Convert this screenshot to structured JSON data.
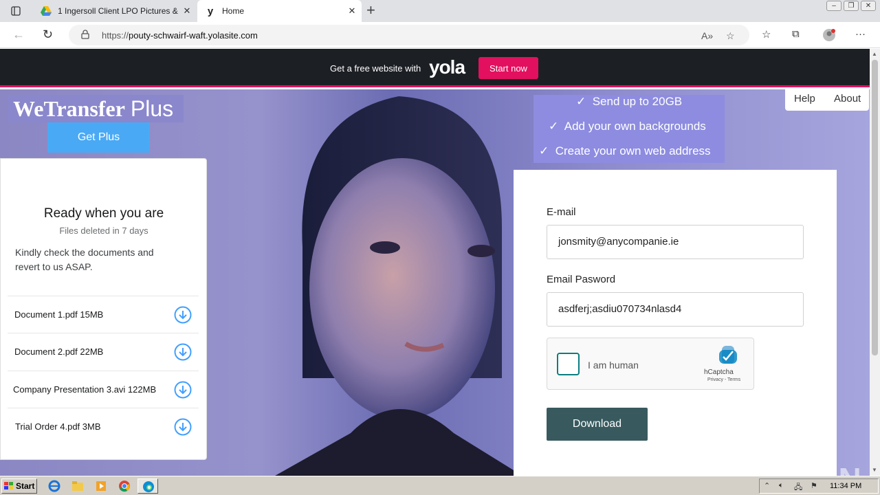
{
  "browser": {
    "tabs": [
      {
        "title": "1 Ingersoll Client LPO Pictures &",
        "active": false
      },
      {
        "title": "Home",
        "active": true
      }
    ],
    "url_prefix": "https://",
    "url_host": "pouty-schwairf-waft.yolasite.com"
  },
  "yola_bar": {
    "text": "Get a free website with",
    "logo": "yola",
    "button": "Start now"
  },
  "hero": {
    "brand": "WeTransfer",
    "brand_suffix": "Plus",
    "get_plus": "Get Plus",
    "features": [
      "Send up to 20GB",
      "Add your own backgrounds",
      "Create your own web address"
    ],
    "nav": {
      "help": "Help",
      "about": "About"
    }
  },
  "card": {
    "title": "Ready when you are",
    "subtitle": "Files deleted in 7 days",
    "message": "Kindly check the documents and revert to us ASAP.",
    "files": [
      "Document 1.pdf 15MB",
      "Document 2.pdf 22MB",
      "Company Presentation 3.avi 122MB",
      "Trial Order 4.pdf 3MB"
    ]
  },
  "form": {
    "email_label": "E-mail",
    "email_value": "jonsmity@anycompanie.ie",
    "password_label": "Email Pasword",
    "password_value": "asdferj;asdiu070734nlasd4",
    "captcha_label": "I am human",
    "captcha_brand": "hCaptcha",
    "captcha_terms": "Privacy - Terms",
    "submit": "Download"
  },
  "watermark": "ANY RUN",
  "taskbar": {
    "start": "Start",
    "clock": "11:34 PM"
  },
  "colors": {
    "yola_accent": "#e3105f",
    "download_button": "#385a5e",
    "get_plus": "#4aa9f4",
    "hcaptcha_checkbox": "#0a7d80"
  }
}
